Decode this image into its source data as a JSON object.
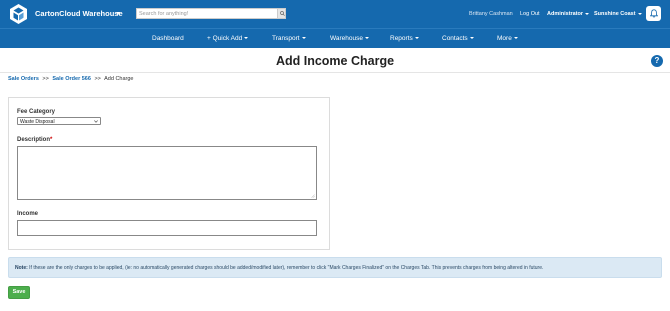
{
  "header": {
    "app_title": "CartonCloud Warehouse",
    "search_placeholder": "Search for anything!",
    "user_name": "Brittany Cashman",
    "logout_label": "Log Out",
    "role_label": "Administrator",
    "location_label": "Sunshine Coast"
  },
  "nav": {
    "items": [
      {
        "label": "Dashboard"
      },
      {
        "label": "+ Quick Add"
      },
      {
        "label": "Transport"
      },
      {
        "label": "Warehouse"
      },
      {
        "label": "Reports"
      },
      {
        "label": "Contacts"
      },
      {
        "label": "More"
      }
    ]
  },
  "page": {
    "title": "Add Income Charge",
    "help_label": "?"
  },
  "breadcrumb": {
    "items": [
      "Sale Orders",
      "Sale Order 566",
      "Add Charge"
    ],
    "separator": ">>"
  },
  "form": {
    "fee_category_label": "Fee Category",
    "fee_category_value": "Waste Disposal",
    "description_label": "Description",
    "description_required_mark": "*",
    "description_value": "",
    "income_label": "Income",
    "income_value": ""
  },
  "note": {
    "prefix": "Note:",
    "text": " If these are the only charges to be applied, (ie: no automatically generated charges should be added/modified later), remember to click \"Mark Charges Finalized\" on the Charges Tab. This prevents charges from being altered in future."
  },
  "actions": {
    "save_label": "Save"
  },
  "colors": {
    "brand_blue": "#1569ae",
    "note_bg": "#dbe9f4",
    "save_green": "#4cae4c"
  }
}
